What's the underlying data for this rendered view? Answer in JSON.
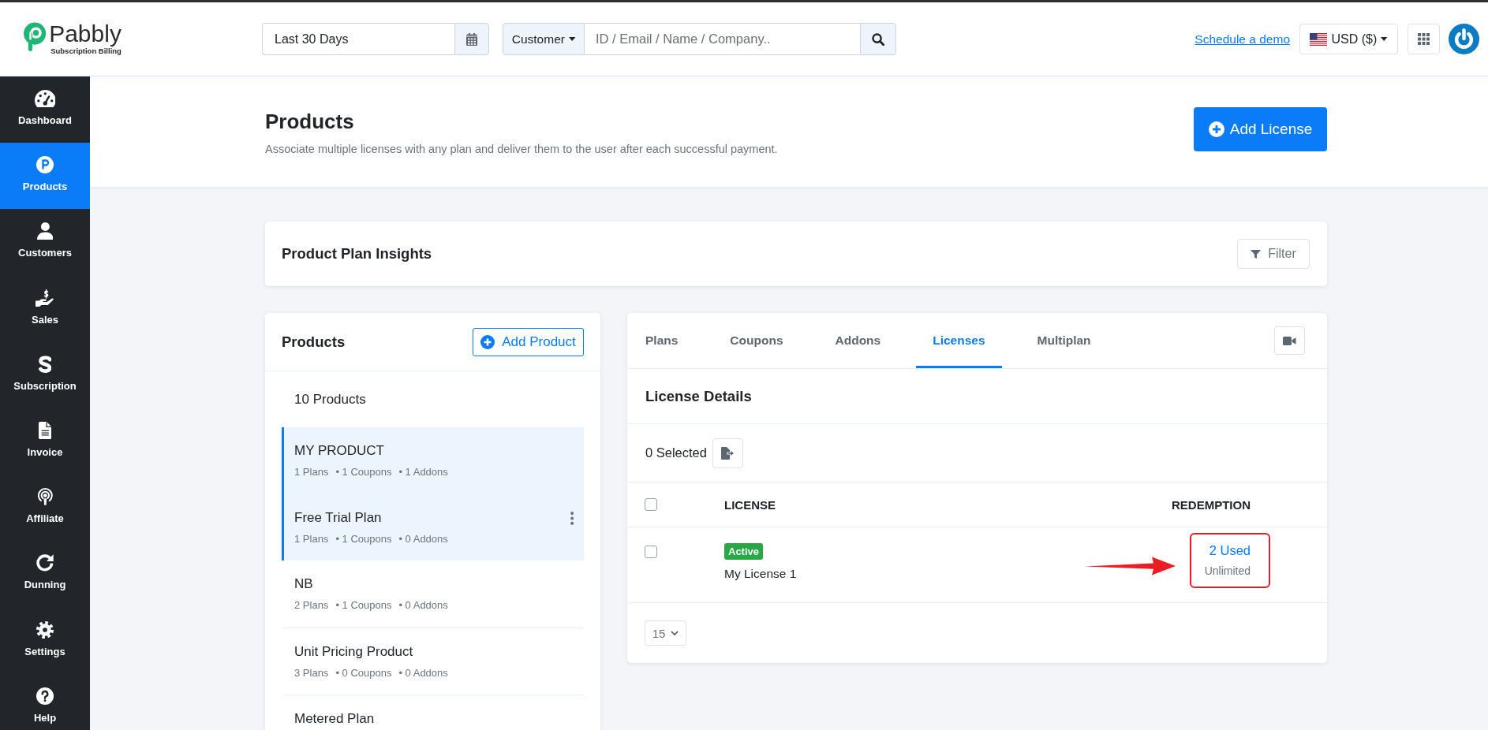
{
  "header": {
    "logo": {
      "name": "Pabbly",
      "tagline": "Subscription Billing"
    },
    "date_range": {
      "value": "Last 30 Days"
    },
    "search": {
      "filter": "Customer",
      "placeholder": "ID / Email / Name / Company.."
    },
    "demo_link": "Schedule a demo",
    "currency": "USD ($)"
  },
  "sidebar": {
    "items": [
      {
        "label": "Dashboard",
        "selected": false
      },
      {
        "label": "Products",
        "selected": true
      },
      {
        "label": "Customers",
        "selected": false
      },
      {
        "label": "Sales",
        "selected": false
      },
      {
        "label": "Subscription",
        "selected": false
      },
      {
        "label": "Invoice",
        "selected": false
      },
      {
        "label": "Affiliate",
        "selected": false
      },
      {
        "label": "Dunning",
        "selected": false
      },
      {
        "label": "Settings",
        "selected": false
      },
      {
        "label": "Help",
        "selected": false
      }
    ]
  },
  "page": {
    "title": "Products",
    "subtitle": "Associate multiple licenses with any plan and deliver them to the user after each successful payment.",
    "add_button": "Add License"
  },
  "insights": {
    "title": "Product Plan Insights",
    "filter_button": "Filter"
  },
  "products_panel": {
    "title": "Products",
    "add_button": "Add Product",
    "count": "10 Products",
    "items": [
      {
        "name": "MY PRODUCT",
        "stats": [
          "1 Plans",
          "• 1 Coupons",
          "• 1 Addons"
        ],
        "selected": true,
        "menu": false
      },
      {
        "name": "Free Trial Plan",
        "stats": [
          "1 Plans",
          "• 1 Coupons",
          "• 0 Addons"
        ],
        "selected": true,
        "menu": true
      },
      {
        "name": "NB",
        "stats": [
          "2 Plans",
          "• 1 Coupons",
          "• 0 Addons"
        ],
        "selected": false,
        "menu": false
      },
      {
        "name": "Unit Pricing Product",
        "stats": [
          "3 Plans",
          "• 0 Coupons",
          "• 0 Addons"
        ],
        "selected": false,
        "menu": false
      },
      {
        "name": "Metered Plan",
        "selected": false,
        "menu": false
      }
    ]
  },
  "licenses_panel": {
    "tabs": [
      {
        "label": "Plans",
        "selected": false
      },
      {
        "label": "Coupons",
        "selected": false
      },
      {
        "label": "Addons",
        "selected": false
      },
      {
        "label": "Licenses",
        "selected": true
      },
      {
        "label": "Multiplan",
        "selected": false
      }
    ],
    "section_title": "License Details",
    "selected_count": "0 Selected",
    "table": {
      "select_all": {
        "checked": false
      },
      "columns": [
        "LICENSE",
        "REDEMPTION"
      ],
      "rows": [
        {
          "checked": false,
          "status": "Active",
          "name": "My License 1",
          "used": "2 Used",
          "limit": "Unlimited",
          "highlighted": true
        }
      ]
    },
    "page_size": "15"
  }
}
